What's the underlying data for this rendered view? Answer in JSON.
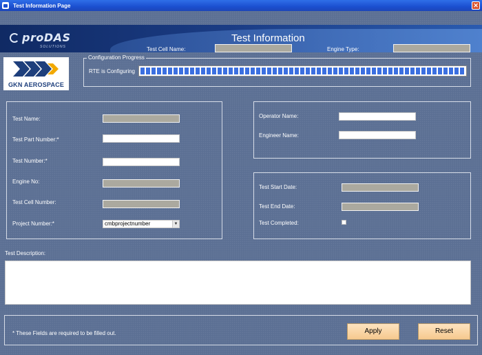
{
  "window": {
    "title": "Test Information Page",
    "icon": "app-window-icon",
    "close_symbol": "✕"
  },
  "banner": {
    "logo_text": "proDAS",
    "logo_sub": "SOLUTIONS",
    "heading": "Test Information"
  },
  "header_fields": {
    "test_cell_name_label": "Test Cell Name:",
    "test_cell_name_value": "",
    "engine_type_label": "Engine Type:",
    "engine_type_value": ""
  },
  "company_logo": {
    "name": "GKN AEROSPACE",
    "brand_color": "#1e3f7c",
    "accent_color": "#f2a900"
  },
  "configuration_progress": {
    "legend": "Configuration Progress",
    "status_label": "RTE is Configuring",
    "progress_fraction": 1.0,
    "bar_color": "#3b6fe0"
  },
  "test_panel": {
    "test_name_label": "Test Name:",
    "test_name_value": "",
    "part_number_label": "Test Part Number:*",
    "part_number_value": "",
    "test_number_label": "Test Number:*",
    "test_number_value": "",
    "engine_no_label": "Engine No:",
    "engine_no_value": "",
    "test_cell_number_label": "Test Cell Number:",
    "test_cell_number_value": "",
    "project_number_label": "Project Number:*",
    "project_number_selected": "cmbprojectnumber"
  },
  "people_panel": {
    "operator_label": "Operator Name:",
    "operator_value": "",
    "engineer_label": "Engineer Name:",
    "engineer_value": ""
  },
  "dates_panel": {
    "start_label": "Test Start Date:",
    "start_value": "",
    "end_label": "Test End Date:",
    "end_value": "",
    "completed_label": "Test Completed:",
    "completed_checked": false
  },
  "description": {
    "label": "Test Description:",
    "value": ""
  },
  "footer": {
    "required_note": "* These Fields are required to be filled out.",
    "apply_label": "Apply",
    "reset_label": "Reset"
  }
}
